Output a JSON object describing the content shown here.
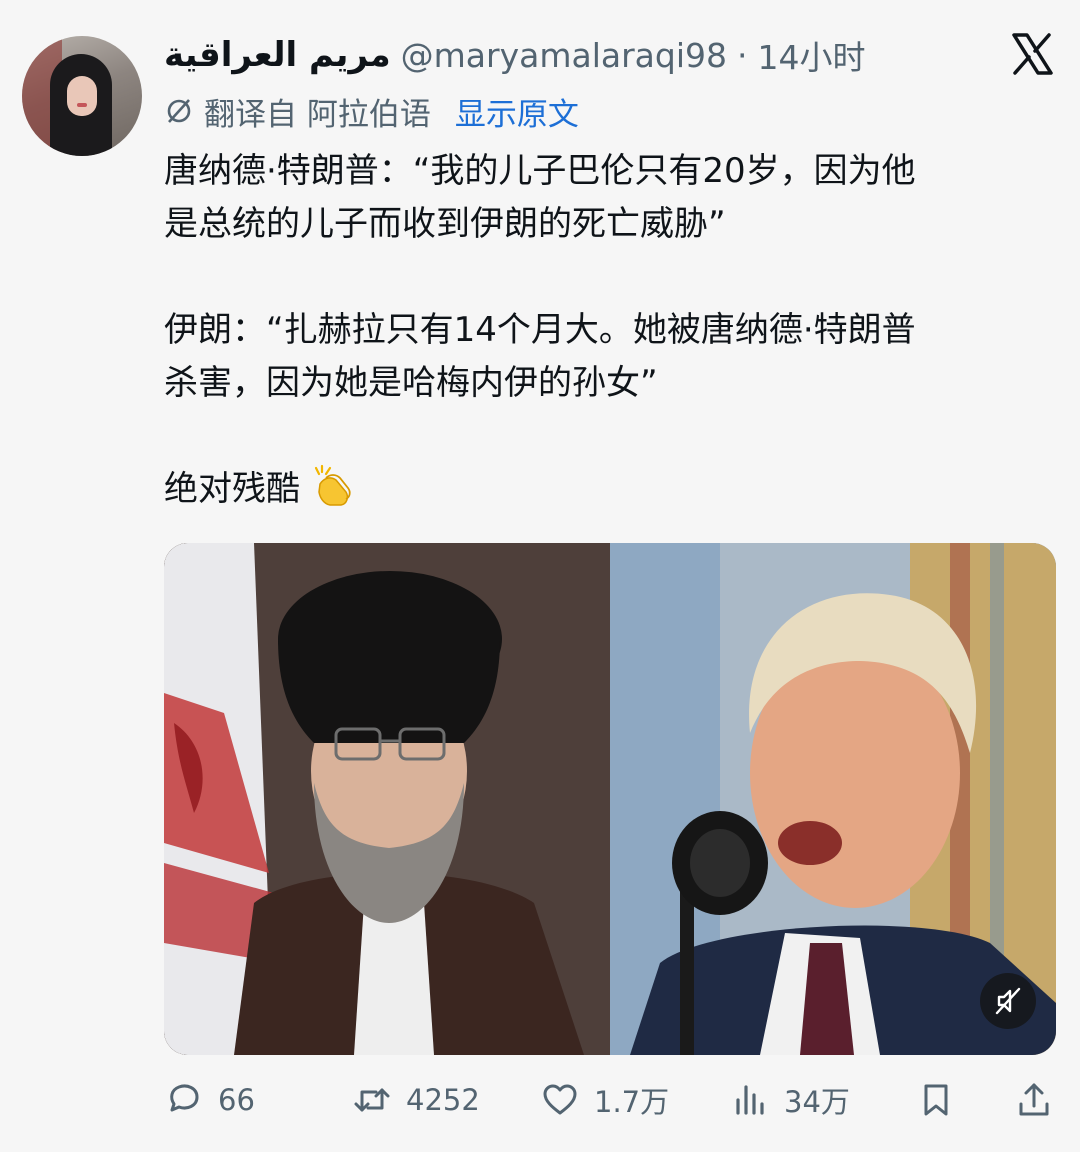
{
  "tweet": {
    "author": {
      "display_name": "مريم العراقية",
      "handle": "@maryamalaraqi98",
      "separator": "·",
      "time": "14小时"
    },
    "translation": {
      "icon": "translate-icon",
      "from_label": "翻译自 阿拉伯语",
      "show_original": "显示原文"
    },
    "text": {
      "line1": "唐纳德·特朗普：“我的儿子巴伦只有20岁，因为他",
      "line2": "是总统的儿子而收到伊朗的死亡威胁”",
      "line3": "伊朗：“扎赫拉只有14个月大。她被唐纳德·特朗普",
      "line4": "杀害，因为她是哈梅内伊的孙女”",
      "line5": "绝对残酷",
      "emoji": "clapping-hands-emoji"
    },
    "media": {
      "mute_icon": "muted-speaker-icon"
    },
    "actions": {
      "replies": "66",
      "retweets": "4252",
      "likes": "1.7万",
      "views": "34万"
    }
  },
  "colors": {
    "text": "#0f1419",
    "secondary": "#536471",
    "link": "#1d6fd6",
    "background": "#f6f6f6"
  }
}
